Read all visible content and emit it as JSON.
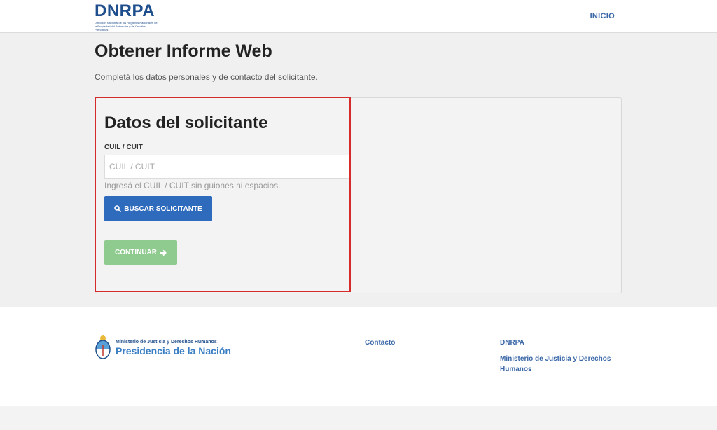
{
  "header": {
    "logo_text": "DNRPA",
    "logo_subtitle": "Dirección Nacional de los Registros Nacionales de la Propiedad del Automotor y de Créditos Prendarios",
    "nav_inicio": "INICIO"
  },
  "main": {
    "title": "Obtener Informe Web",
    "subtitle": "Completá los datos personales y de contacto del solicitante.",
    "section_title": "Datos del solicitante",
    "cuil_label": "CUIL / CUIT",
    "cuil_placeholder": "CUIL / CUIT",
    "cuil_value": "",
    "cuil_help": "Ingresá el CUIL / CUIT sin guiones ni espacios.",
    "buscar_label": "BUSCAR SOLICITANTE",
    "continuar_label": "CONTINUAR"
  },
  "footer": {
    "ministry_small": "Ministerio de Justicia y Derechos Humanos",
    "ministry_big": "Presidencia de la Nación",
    "contacto": "Contacto",
    "dnrpa": "DNRPA",
    "ministerio": "Ministerio de Justicia y Derechos Humanos"
  },
  "colors": {
    "primary_button": "#2f6bbd",
    "success_button": "#8fca8f",
    "highlight_border": "#d62b2b",
    "brand": "#1f4e8c"
  },
  "icons": {
    "search": "search-icon",
    "arrow": "arrow-right-icon",
    "coat_of_arms": "coat-of-arms-icon"
  }
}
